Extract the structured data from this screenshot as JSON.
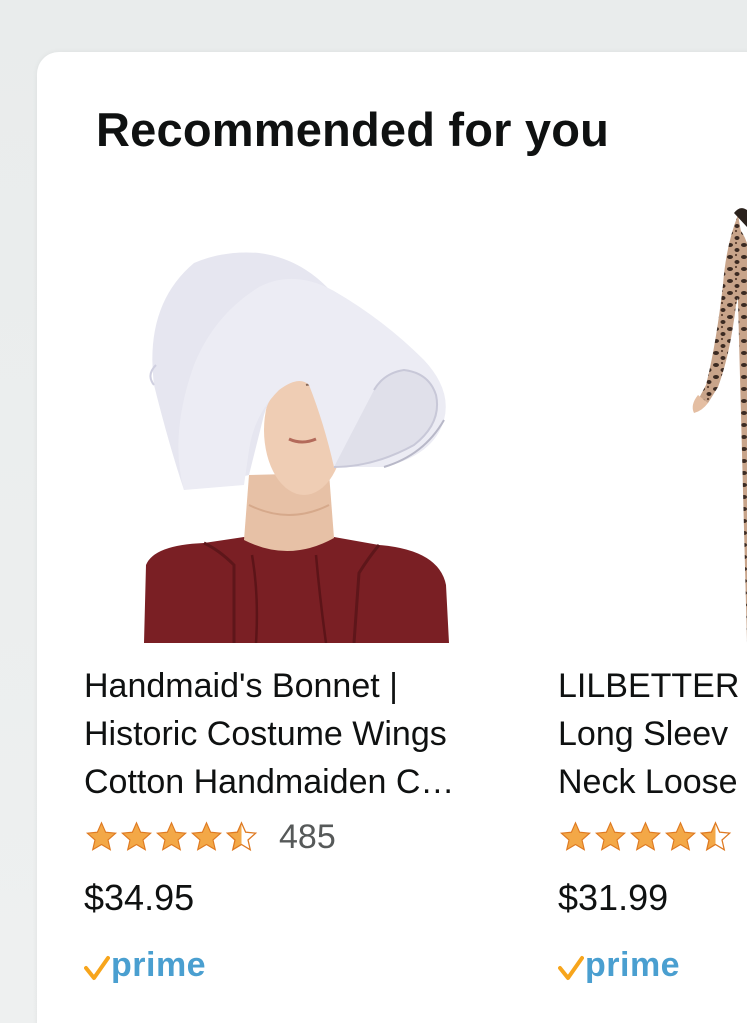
{
  "section": {
    "title": "Recommended for you"
  },
  "colors": {
    "star": "#f3a847",
    "prime_check": "#f7a51c",
    "prime_text": "#4a9fd0",
    "text": "#0f1111",
    "muted": "#565959"
  },
  "products": [
    {
      "title": "Handmaid's Bonnet |\nHistoric Costume Wings\nCotton Handmaiden C…",
      "rating": 4.5,
      "review_count": "485",
      "price": "$34.95",
      "prime_label": "prime",
      "image_icon": "white-bonnet-photo"
    },
    {
      "title": "LILBETTER\nLong Sleev\nNeck Loose",
      "rating": 4.5,
      "review_count": "",
      "price": "$31.99",
      "prime_label": "prime",
      "image_icon": "leopard-dress-photo"
    }
  ]
}
